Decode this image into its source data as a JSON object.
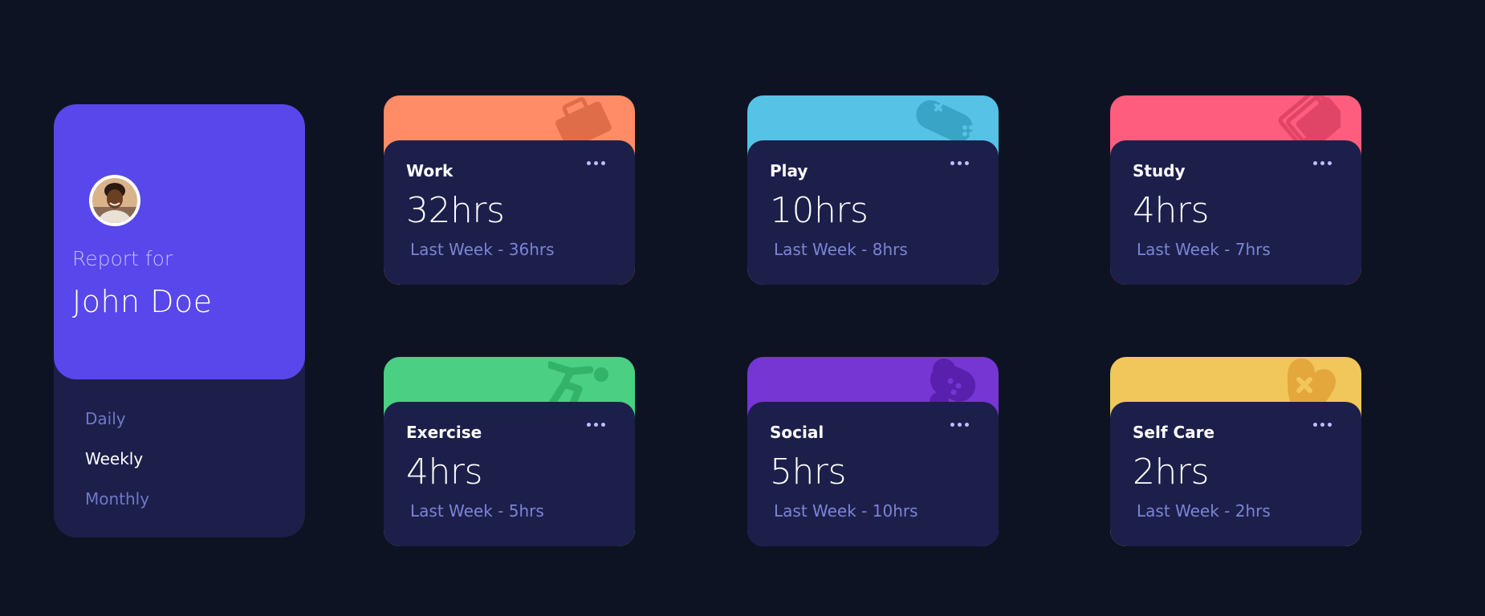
{
  "profile": {
    "report_for": "Report for",
    "name": "John Doe",
    "periods": [
      {
        "label": "Daily",
        "active": false
      },
      {
        "label": "Weekly",
        "active": true
      },
      {
        "label": "Monthly",
        "active": false
      }
    ]
  },
  "activities": [
    {
      "title": "Work",
      "current": "32hrs",
      "previous": "Last Week - 36hrs",
      "color": "#ff8c66",
      "icon": "briefcase-icon"
    },
    {
      "title": "Play",
      "current": "10hrs",
      "previous": "Last Week - 8hrs",
      "color": "#56c2e6",
      "icon": "gamepad-icon"
    },
    {
      "title": "Study",
      "current": "4hrs",
      "previous": "Last Week - 7hrs",
      "color": "#ff5d7d",
      "icon": "books-icon"
    },
    {
      "title": "Exercise",
      "current": "4hrs",
      "previous": "Last Week - 5hrs",
      "color": "#4bcf83",
      "icon": "running-icon"
    },
    {
      "title": "Social",
      "current": "5hrs",
      "previous": "Last Week - 10hrs",
      "color": "#7536d3",
      "icon": "social-icon"
    },
    {
      "title": "Self Care",
      "current": "2hrs",
      "previous": "Last Week - 2hrs",
      "color": "#f1c65b",
      "icon": "heart-icon"
    }
  ],
  "colors": {
    "background": "#0e1323",
    "card": "#1c1f4a",
    "accent": "#5847eb",
    "muted_text": "#7078c9"
  }
}
